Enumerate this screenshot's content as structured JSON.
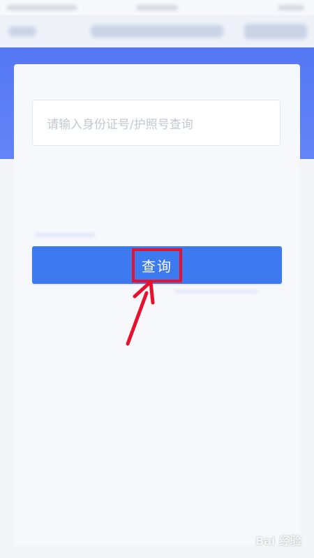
{
  "search": {
    "placeholder": "请输入身份证号/护照号查询",
    "button_label": "查询"
  },
  "watermark": {
    "text": "Bai 经验"
  },
  "colors": {
    "hero_blue": "#5577f3",
    "button_blue": "#3d79ef",
    "highlight_red": "#e8112d",
    "arrow_red": "#e8112d"
  }
}
